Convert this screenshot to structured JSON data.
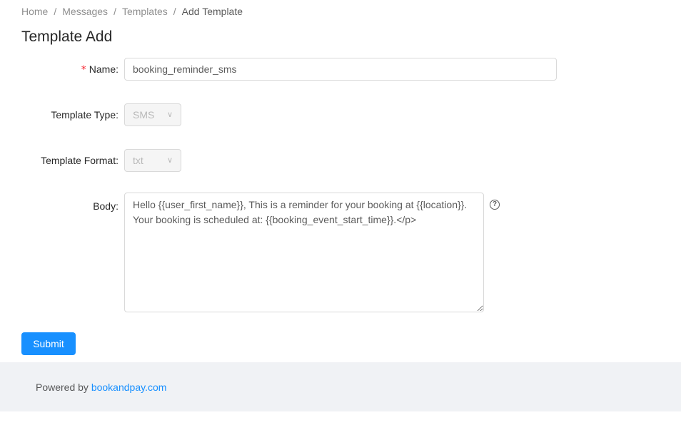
{
  "breadcrumb": [
    "Home",
    "Messages",
    "Templates",
    "Add Template"
  ],
  "title": "Template Add",
  "form": {
    "name_label": "Name:",
    "name_value": "booking_reminder_sms",
    "type_label": "Template Type:",
    "type_value": "SMS",
    "format_label": "Template Format:",
    "format_value": "txt",
    "body_label": "Body:",
    "body_value": "Hello {{user_first_name}}, This is a reminder for your booking at {{location}}. Your booking is scheduled at: {{booking_event_start_time}}.</p>",
    "help_icon": "question-circle-icon",
    "chevron_icon": "chevron-down-icon"
  },
  "submit_label": "Submit",
  "footer": {
    "prefix": "Powered by ",
    "link": "bookandpay.com"
  },
  "colors": {
    "primary": "#1890ff",
    "required": "#f5222d",
    "footer_bg": "#f0f2f5"
  }
}
